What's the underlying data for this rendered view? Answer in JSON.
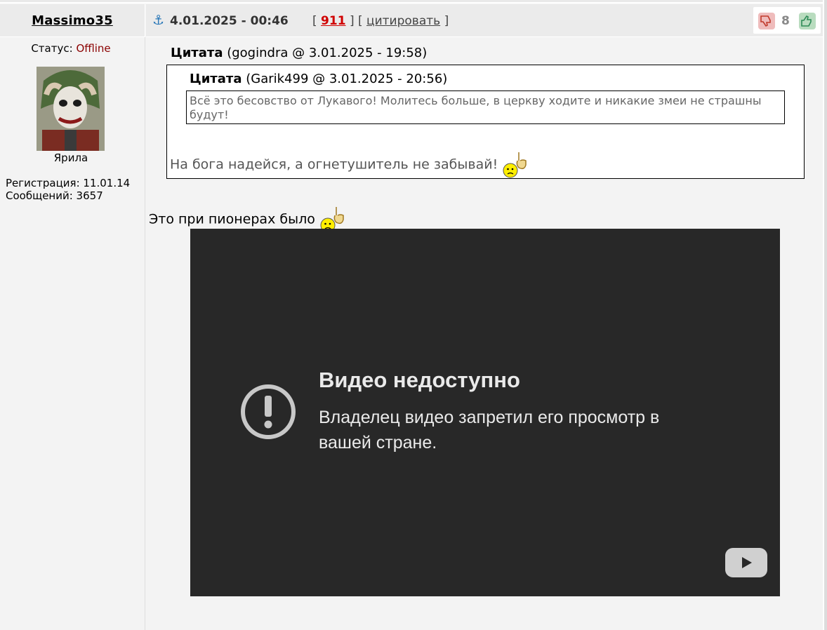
{
  "post": {
    "author": "Massimo35",
    "date": "4.01.2025 - 00:46",
    "bracket_open": "[",
    "number": "911",
    "bracket_mid": "] [",
    "quote_action": "цитировать",
    "bracket_close": "]",
    "rating": "8",
    "reply_text": "Это при пионерах было"
  },
  "user": {
    "status_label": "Статус:",
    "status_value": "Offline",
    "rank": "Ярила",
    "registration": "Регистрация: 11.01.14",
    "messages": "Сообщений: 3657"
  },
  "quotes": {
    "outer_label": "Цитата",
    "outer_source": "(gogindra @ 3.01.2025 - 19:58)",
    "outer_text": "На бога надейся, а огнетушитель не забывай!",
    "inner_label": "Цитата",
    "inner_source": "(Garik499 @ 3.01.2025 - 20:56)",
    "inner_text": "Всё это бесовство от Лукавого! Молитесь больше, в церкву ходите и никакие змеи не страшны будут!"
  },
  "video": {
    "title": "Видео недоступно",
    "message": "Владелец видео запретил его просмотр в вашей стране."
  },
  "icons": {
    "anchor": "anchor-icon",
    "thumb_down": "thumb-down-icon",
    "thumb_up": "thumb-up-icon",
    "smiley": "pointing-smiley-icon",
    "error": "exclamation-icon",
    "youtube": "youtube-play-icon"
  },
  "colors": {
    "post_number": "#d00000",
    "offline": "#8b0000",
    "video_bg": "#282828"
  }
}
